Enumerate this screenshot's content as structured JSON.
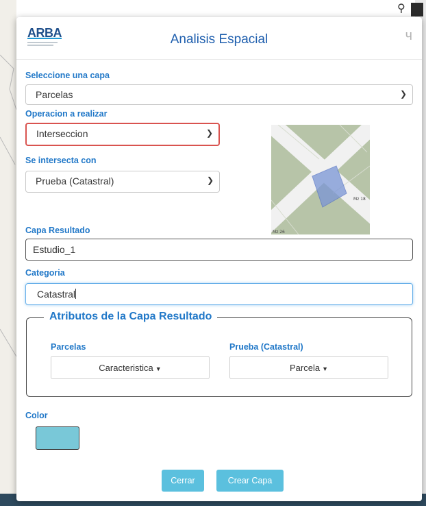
{
  "modal": {
    "logo_text": "ARBA",
    "title": "Analisis Espacial",
    "close_glyph": "ч"
  },
  "layer_select": {
    "label": "Seleccione una capa",
    "value": "Parcelas"
  },
  "operation_select": {
    "label": "Operacion a realizar",
    "value": "Interseccion"
  },
  "intersects_select": {
    "label": "Se intersecta con",
    "value": "Prueba (Catastral)"
  },
  "thumbnail": {
    "labels": [
      "Mz 18",
      "Mz 26"
    ]
  },
  "result_layer": {
    "label": "Capa Resultado",
    "value": "Estudio_1"
  },
  "category": {
    "label": "Categoria",
    "value": "Catastral"
  },
  "attributes": {
    "legend": "Atributos de la Capa Resultado",
    "left_label": "Parcelas",
    "left_button": "Caracteristica",
    "right_label": "Prueba (Catastral)",
    "right_button": "Parcela"
  },
  "color": {
    "label": "Color",
    "value": "#79c8d8"
  },
  "buttons": {
    "close": "Cerrar",
    "create": "Crear Capa"
  },
  "icons": {
    "search": "search-icon",
    "close": "close-icon",
    "chevron": "chevron-down-icon",
    "caret": "caret-down-icon"
  }
}
